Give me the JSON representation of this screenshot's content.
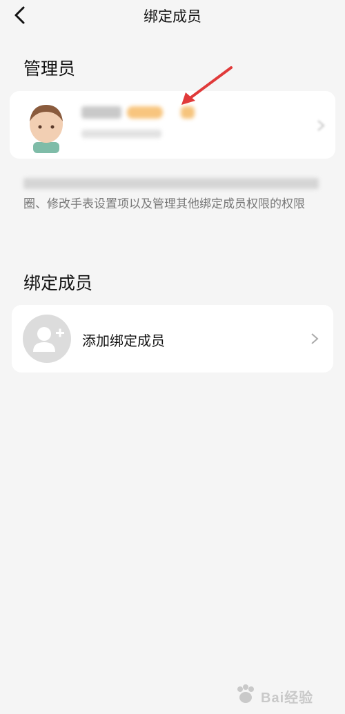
{
  "header": {
    "title": "绑定成员"
  },
  "admin_section": {
    "title": "管理员",
    "description_visible": "圈、修改手表设置项以及管理其他绑定成员权限的权限"
  },
  "bound_section": {
    "title": "绑定成员",
    "add_button_label": "添加绑定成员"
  },
  "watermark": {
    "text": "Bai经验"
  },
  "icons": {
    "back": "chevron-left-icon",
    "add_member": "add-user-icon",
    "chevron": "chevron-right-icon",
    "annotation": "red-arrow-icon"
  },
  "colors": {
    "background": "#f5f5f5",
    "card": "#ffffff",
    "annotation": "#e03a3a",
    "tag": "#f8c57e"
  }
}
